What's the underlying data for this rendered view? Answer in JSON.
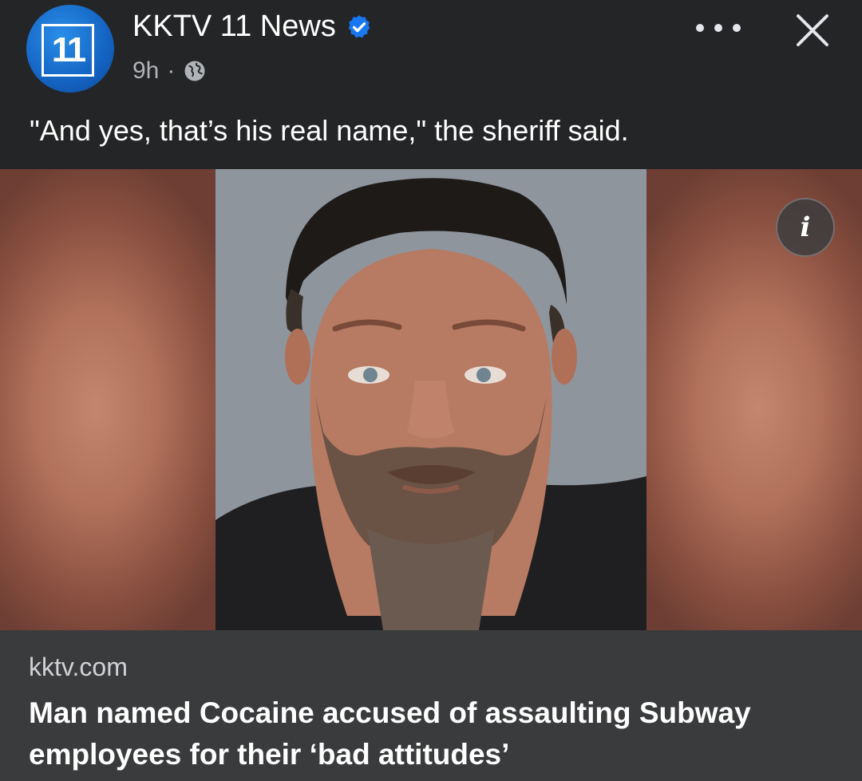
{
  "post": {
    "page_name": "KKTV 11 News",
    "avatar_text": "11",
    "time": "9h",
    "separator": "·",
    "audience_icon": "globe-icon",
    "verified_icon": "verified-badge-icon",
    "caption": "\"And yes, that’s his real name,\" the sheriff said."
  },
  "link_preview": {
    "domain": "kktv.com",
    "headline": "Man named Cocaine accused of assaulting Subway employees for their ‘bad attitudes’"
  },
  "controls": {
    "more_icon": "more-options-icon",
    "close_icon": "close-icon",
    "info_label": "i"
  },
  "colors": {
    "background": "#242526",
    "card": "#3a3b3c",
    "brand_blue": "#1463c2",
    "verified_blue": "#1877f2",
    "secondary_text": "#b0b3b8"
  }
}
